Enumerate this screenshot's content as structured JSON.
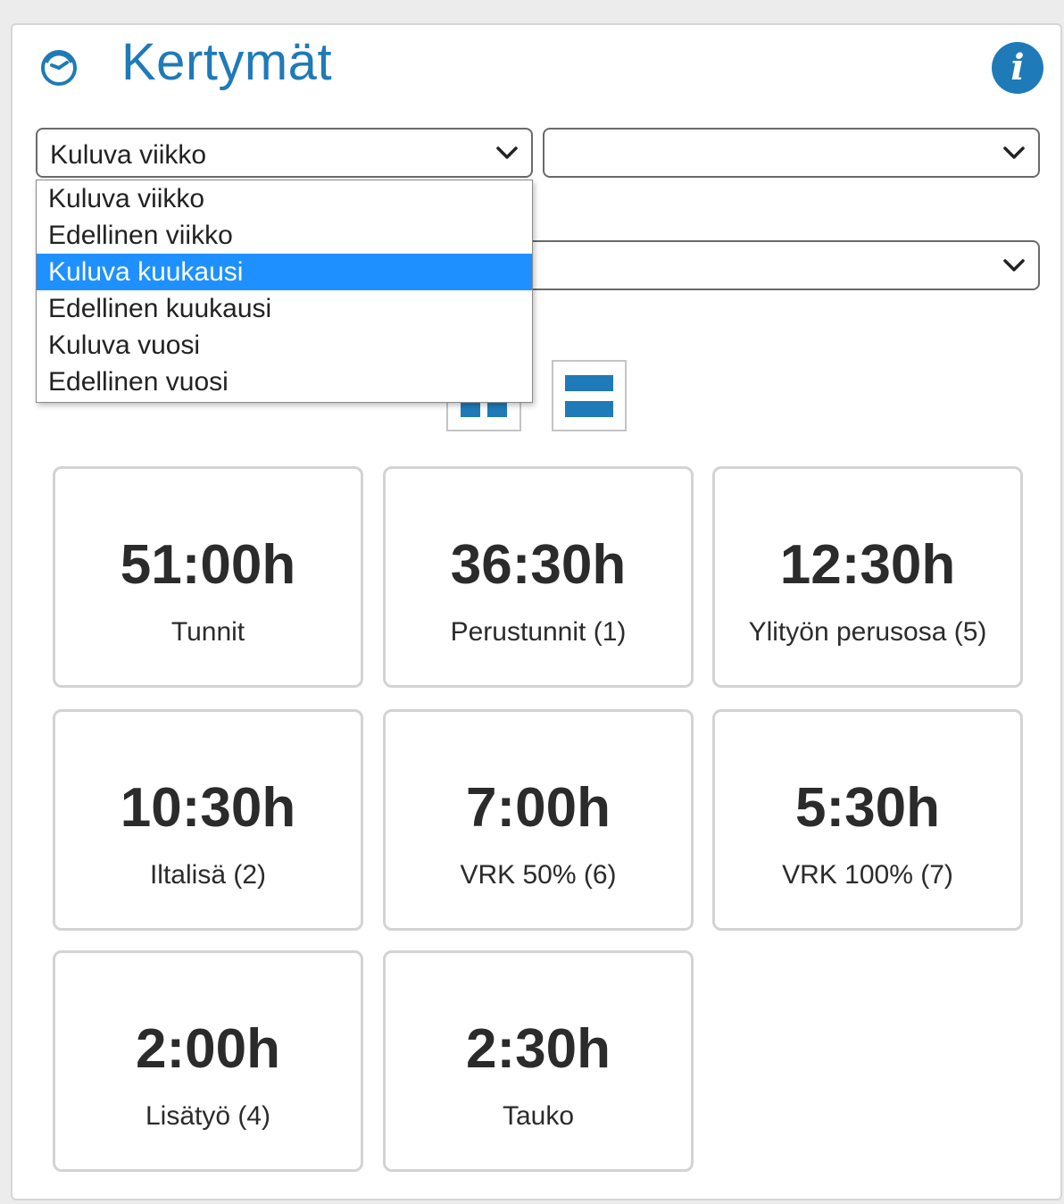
{
  "header": {
    "title": "Kertymät",
    "icon": "clock-icon",
    "info_icon": "info-icon",
    "info_label": "i",
    "accent_color": "#1f7ab8"
  },
  "filters": {
    "period": {
      "value": "Kuluva viikko"
    },
    "second": {
      "value": ""
    },
    "third": {
      "value": ""
    }
  },
  "dropdown": {
    "options": [
      "Kuluva viikko",
      "Edellinen viikko",
      "Kuluva kuukausi",
      "Edellinen kuukausi",
      "Kuluva vuosi",
      "Edellinen vuosi"
    ],
    "highlighted": "Kuluva kuukausi",
    "highlight_color": "#1e90ff"
  },
  "view_toggle": {
    "grid_icon": "grid-view-icon",
    "list_icon": "list-view-icon"
  },
  "cards": [
    {
      "value": "51:00h",
      "label": "Tunnit"
    },
    {
      "value": "36:30h",
      "label": "Perustunnit (1)"
    },
    {
      "value": "12:30h",
      "label": "Ylityön perusosa (5)"
    },
    {
      "value": "10:30h",
      "label": "Iltalisä (2)"
    },
    {
      "value": "7:00h",
      "label": "VRK 50% (6)"
    },
    {
      "value": "5:30h",
      "label": "VRK 100% (7)"
    },
    {
      "value": "2:00h",
      "label": "Lisätyö (4)"
    },
    {
      "value": "2:30h",
      "label": "Tauko"
    }
  ]
}
